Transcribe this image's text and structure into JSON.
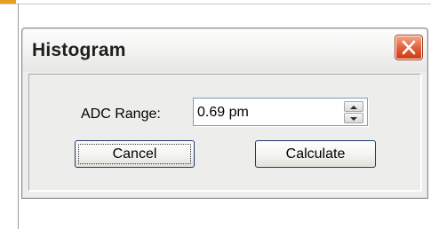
{
  "dialog": {
    "title": "Histogram",
    "close_icon": "close-icon"
  },
  "adc_range": {
    "label": "ADC Range:",
    "value": "0.69 pm",
    "spinner_up_icon": "arrow-up-icon",
    "spinner_down_icon": "arrow-down-icon"
  },
  "buttons": {
    "cancel_label": "Cancel",
    "calculate_label": "Calculate"
  },
  "colors": {
    "close_button": "#e4603c",
    "dialog_background": "#ededeb",
    "input_border": "#7f9db9"
  }
}
